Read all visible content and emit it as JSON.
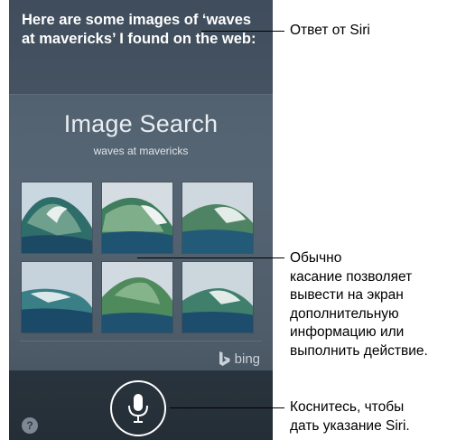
{
  "siri": {
    "response_text": "Here are some images of ‘waves at mavericks’ I found on the web:"
  },
  "image_search": {
    "title": "Image Search",
    "query": "waves at mavericks",
    "provider": "bing",
    "provider_icon": "bing-logo-icon",
    "thumbnail_count": 6
  },
  "controls": {
    "mic_icon": "microphone-icon",
    "help_label": "?"
  },
  "callouts": {
    "siri_answer": "Ответ от Siri",
    "tap_info": [
      "Обычно",
      "касание позволяет",
      "вывести на экран",
      "дополнительную",
      "информацию или",
      "выполнить действие."
    ],
    "tap_mic": [
      "Коснитесь, чтобы",
      "дать указание Siri."
    ]
  },
  "colors": {
    "screen_bg": "#45525f",
    "text_light": "#ffffff",
    "accent_bing": "#c9d1d9",
    "ocean_deep": "#1d4f6e",
    "wave_green": "#5d8c72"
  }
}
